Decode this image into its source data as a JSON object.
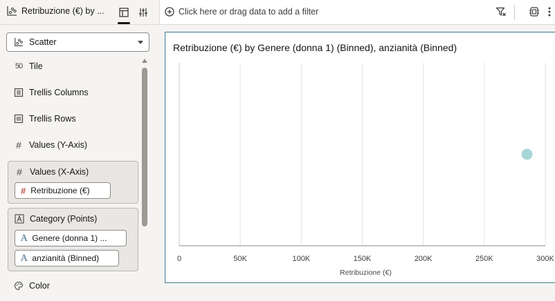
{
  "left_header": {
    "title": "Retribuzione (€) by ...",
    "tabs": [
      {
        "name": "grammar-tab-button",
        "icon": "panel-icon"
      },
      {
        "name": "properties-tab-button",
        "icon": "sliders-icon"
      }
    ]
  },
  "filter_bar": {
    "add_filter_label": "Click here or drag data to add a filter"
  },
  "grammar": {
    "chart_type": "Scatter",
    "sections": [
      {
        "label": "Tile",
        "icon": "tile-icon"
      },
      {
        "label": "Trellis Columns",
        "icon": "trellis-columns-icon"
      },
      {
        "label": "Trellis Rows",
        "icon": "trellis-rows-icon"
      },
      {
        "label": "Values (Y-Axis)",
        "icon": "hash-icon"
      },
      {
        "label": "Values (X-Axis)",
        "icon": "hash-icon"
      },
      {
        "label": "Category (Points)",
        "icon": "text-type-icon"
      },
      {
        "label": "Color",
        "icon": "palette-icon"
      }
    ],
    "x_axis_items": [
      {
        "label": "Retribuzione (€)",
        "type": "number"
      }
    ],
    "category_items": [
      {
        "label": "Genere (donna 1) ...",
        "type": "text"
      },
      {
        "label": "anzianità (Binned)",
        "type": "text"
      }
    ]
  },
  "viz": {
    "title": "Retribuzione (€) by Genere (donna 1) (Binned), anzianità (Binned)"
  },
  "colors": {
    "accent": "#3a7b8c",
    "point": "#a9d5d8",
    "number_glyph": "#c0554a",
    "text_glyph": "#3f6c8d"
  },
  "chart_data": {
    "type": "scatter",
    "title": "Retribuzione (€) by Genere (donna 1) (Binned), anzianità (Binned)",
    "xlabel": "Retribuzione (€)",
    "ylabel": "",
    "xlim": [
      0,
      300000
    ],
    "x_ticks": [
      0,
      50000,
      100000,
      150000,
      200000,
      250000,
      300000
    ],
    "x_tick_labels": [
      "0",
      "50K",
      "100K",
      "150K",
      "200K",
      "250K",
      "300K"
    ],
    "grid": true,
    "points": [
      {
        "x": 285000,
        "y": 0.5
      }
    ]
  }
}
